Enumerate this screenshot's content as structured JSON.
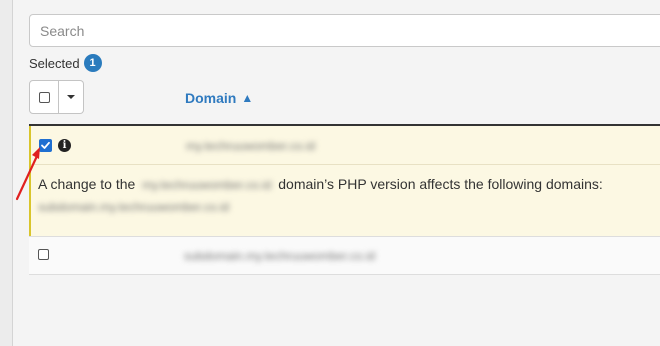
{
  "search": {
    "placeholder": "Search",
    "value": ""
  },
  "selection": {
    "label": "Selected",
    "count": "1"
  },
  "table": {
    "columns": [
      {
        "label": "Domain",
        "sort": "▲"
      }
    ],
    "rows": [
      {
        "selected": true,
        "domain": "my.techruuwomber.co.id",
        "notice": {
          "prefix": "A change to the",
          "domain": "my.techruuwomber.co.id",
          "suffix": "domain’s PHP version affects the following domains:",
          "affected": "subdomain.my.techruuwomber.co.id"
        }
      },
      {
        "selected": false,
        "domain": "subdomain.my.techruuwomber.co.id"
      }
    ]
  },
  "colors": {
    "accent": "#2f7abf",
    "badge": "#2a7bbd",
    "selected_row": "#fcf8e3",
    "selected_border": "#d9c52c",
    "annotation_arrow": "#e02020"
  },
  "icons": {
    "info": "info-icon",
    "caret": "caret-down-icon",
    "sort": "sort-ascending-icon"
  }
}
